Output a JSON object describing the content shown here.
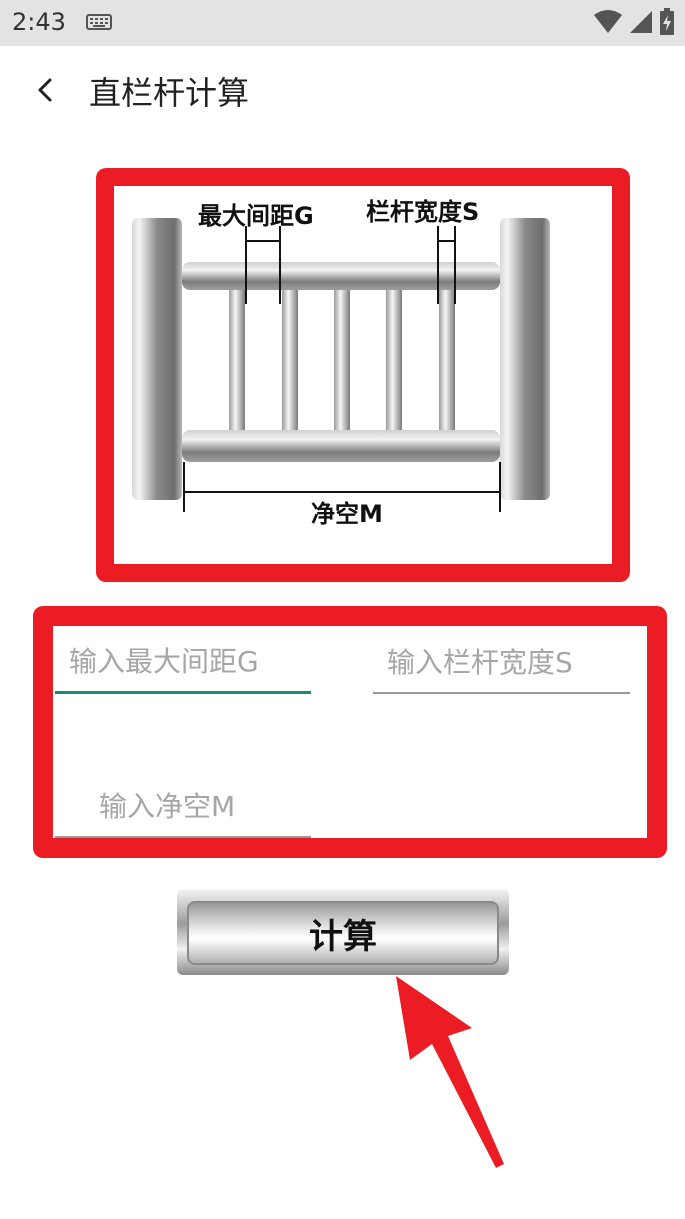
{
  "status_bar": {
    "time": "2:43"
  },
  "toolbar": {
    "title": "直栏杆计算"
  },
  "diagram": {
    "label_gap": "最大间距G",
    "label_width": "栏杆宽度S",
    "label_clear": "净空M"
  },
  "inputs": {
    "gap_placeholder": "输入最大间距G",
    "width_placeholder": "输入栏杆宽度S",
    "clear_placeholder": "输入净空M"
  },
  "calc_button": {
    "label": "计算"
  },
  "colors": {
    "accent_red": "#ec1c24",
    "focus_teal": "#1a8a7e"
  }
}
